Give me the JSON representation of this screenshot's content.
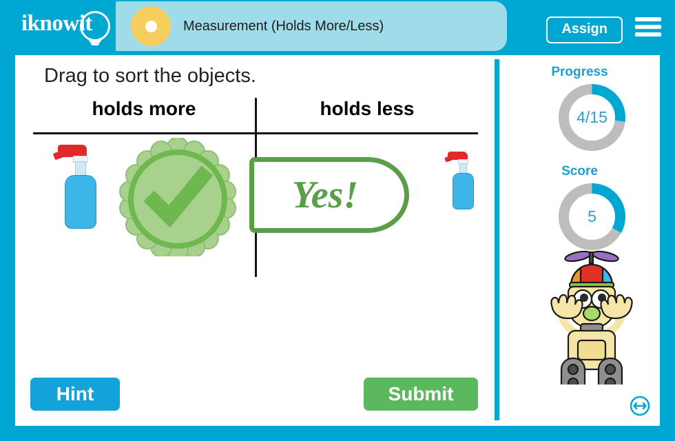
{
  "brand": {
    "logo_text": "iknowit",
    "accent_color": "#00a7d1",
    "title_pill_color": "#9fdcea",
    "dot_color": "#f5ce5e"
  },
  "header": {
    "title": "Measurement (Holds More/Less)",
    "assign_label": "Assign",
    "menu_icon": "hamburger-menu-icon",
    "logo_icon": "lightbulb-icon",
    "bullet_icon": "topic-dot-icon"
  },
  "activity": {
    "prompt": "Drag to sort the objects.",
    "columns": [
      {
        "id": "holds-more",
        "label": "holds more"
      },
      {
        "id": "holds-less",
        "label": "holds less"
      }
    ],
    "objects": [
      {
        "id": "spray-bottle-large",
        "name": "spray-bottle-icon",
        "column": "holds more",
        "size": "large"
      },
      {
        "id": "spray-bottle-small",
        "name": "spray-bottle-icon",
        "column": "holds less",
        "size": "small"
      }
    ]
  },
  "feedback": {
    "message": "Yes!",
    "seal_icon": "checkmark-seal-icon",
    "color": "#5a9e4a",
    "seal_fill": "#a9d18e",
    "visible": true
  },
  "controls": {
    "hint_label": "Hint",
    "submit_label": "Submit",
    "hint_color": "#14a3d8",
    "submit_color": "#5cb85c"
  },
  "sidebar": {
    "progress": {
      "label": "Progress",
      "value": "4/15",
      "completed": 4,
      "total": 15,
      "percent": 27,
      "arc_color": "#00a7d1",
      "track_color": "#bdbdbd"
    },
    "score": {
      "label": "Score",
      "value": "5",
      "percent": 33,
      "arc_color": "#00a7d1",
      "track_color": "#bdbdbd"
    },
    "mascot": {
      "name": "robot-mascot-icon",
      "description": "robot with propeller beanie"
    },
    "resize_icon": "resize-horizontal-icon"
  }
}
